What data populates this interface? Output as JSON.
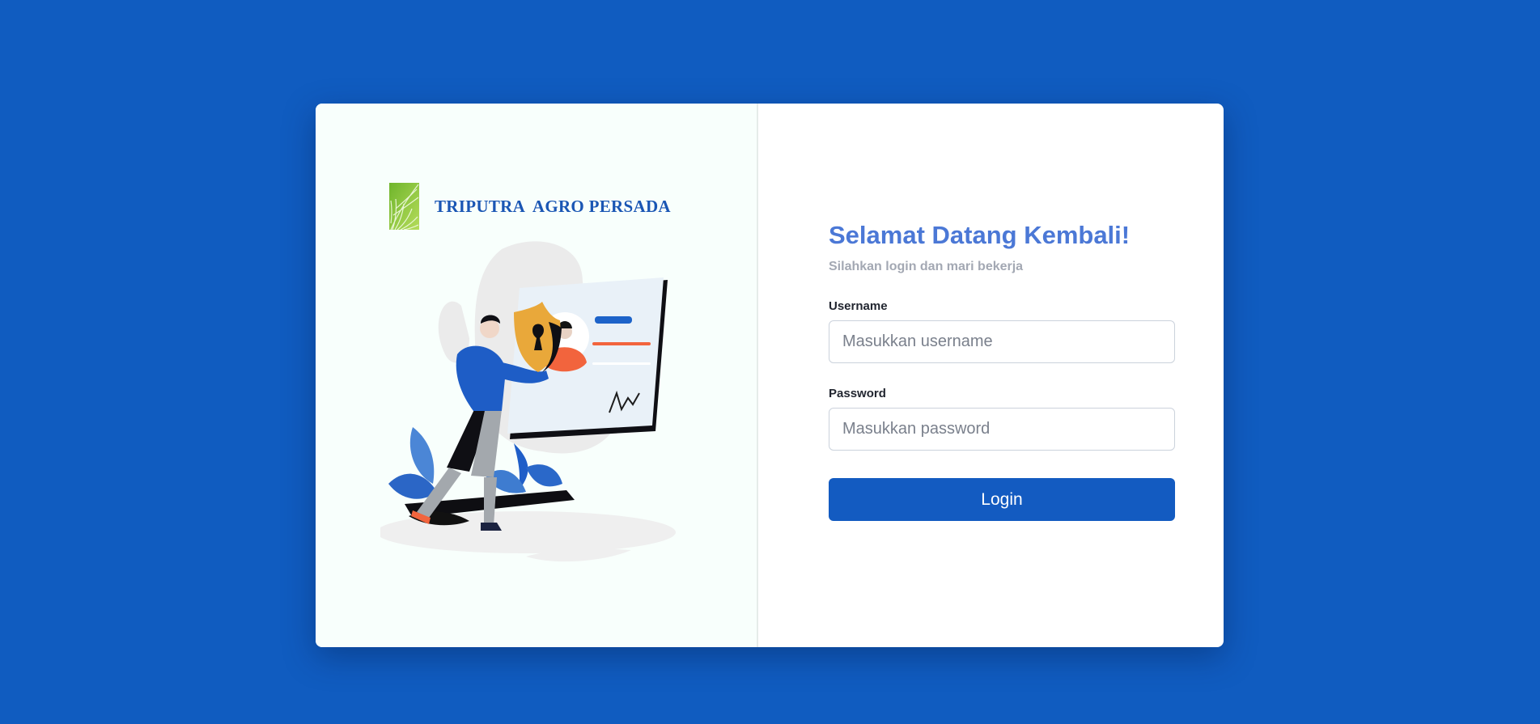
{
  "brand": {
    "company_name": "TRIPUTRA  AGRO PERSADA",
    "logo_icon": "palm-leaf-icon",
    "logo_color": "#8cc63e",
    "text_color": "#1a56b4"
  },
  "illustration": {
    "icon": "secure-identity-illustration"
  },
  "login_form": {
    "title": "Selamat Datang Kembali!",
    "subtitle": "Silahkan login dan mari bekerja",
    "username_label": "Username",
    "username_placeholder": "Masukkan username",
    "username_value": "",
    "password_label": "Password",
    "password_placeholder": "Masukkan password",
    "password_value": "",
    "submit_label": "Login"
  },
  "colors": {
    "page_background": "#105cc0",
    "accent": "#135bc1",
    "title": "#4b78d6"
  }
}
